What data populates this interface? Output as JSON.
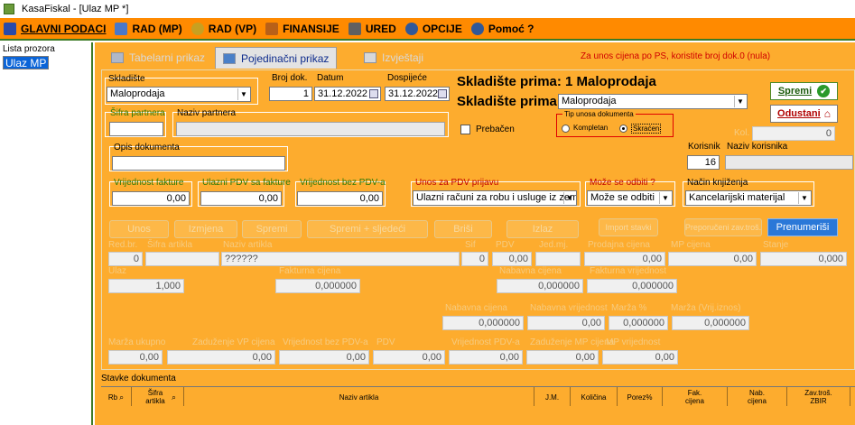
{
  "window": {
    "title": "KasaFiskal  - [Ulaz MP *]"
  },
  "menu": [
    {
      "label": "GLAVNI PODACI",
      "icon": "book-icon",
      "color": "#2a4aa8"
    },
    {
      "label": "RAD (MP)",
      "icon": "notepad-icon",
      "color": "#2a4aa8"
    },
    {
      "label": "RAD (VP)",
      "icon": "coins-icon",
      "color": "#c8a020"
    },
    {
      "label": "FINANSIJE",
      "icon": "box-icon",
      "color": "#b86018"
    },
    {
      "label": "URED",
      "icon": "tools-icon",
      "color": "#404040"
    },
    {
      "label": "OPCIJE",
      "icon": "globe-icon",
      "color": "#305898"
    },
    {
      "label": "Pomoć ?",
      "icon": "help-icon",
      "color": "#305898"
    }
  ],
  "sidebar": {
    "title": "Lista prozora",
    "selected": "Ulaz MP"
  },
  "tabs": [
    {
      "label": "Tabelarni prikaz"
    },
    {
      "label": "Pojedinačni prikaz"
    },
    {
      "label": "Izvještaji"
    }
  ],
  "notice": "Za unos cijena po PS, koristite broj dok.0 (nula)",
  "header": {
    "skladiste_label": "Skladište",
    "skladiste_value": "Maloprodaja",
    "broj_dok_label": "Broj dok.",
    "broj_dok_value": "1",
    "datum_label": "Datum",
    "datum_value": "31.12.2022",
    "dospijece_label": "Dospijeće",
    "dospijece_value": "31.12.2022",
    "big_title": "Skladište prima: 1 Maloprodaja",
    "prima_label": "Skladište prima:",
    "prima_value": "Maloprodaja",
    "sifra_partnera_label": "Šifra partnera",
    "naziv_partnera_label": "Naziv partnera",
    "prebacen_label": "Prebačen",
    "tip_unosa_label": "Tip unosa dokumenta",
    "kompletan_label": "Kompletan",
    "skracen_label": "Skraćen",
    "kol_label": "Kol.",
    "kol_value": "0",
    "korisnik_label": "Korisnik",
    "korisnik_value": "16",
    "naziv_korisnika_label": "Naziv korisnika",
    "opis_label": "Opis dokumenta",
    "vrijednost_fakture_label": "Vrijednost fakture",
    "vrijednost_fakture_value": "0,00",
    "ulazni_pdv_label": "Ulazni PDV sa fakture",
    "ulazni_pdv_value": "0,00",
    "bez_pdv_label": "Vrijednost bez PDV-a",
    "bez_pdv_value": "0,00",
    "unos_pdv_label": "Unos za PDV prijavu",
    "unos_pdv_value": "Ulazni računi za robu i usluge iz zemlje",
    "moze_odbiti_label": "Može se odbiti ?",
    "moze_odbiti_value": "Može se odbiti",
    "nacin_knjizenja_label": "Način knjiženja",
    "nacin_knjizenja_value": "Kancelarijski materijal",
    "spremi": "Spremi",
    "odustani": "Odustani"
  },
  "actions": {
    "unos": "Unos",
    "izmjena": "Izmjena",
    "spremi": "Spremi",
    "spremi_sljedeci": "Spremi + sljedeći",
    "brisi": "Briši",
    "izlaz": "Izlaz",
    "import": "Import stavki",
    "preporuceni": "Preporučeni zav.troš.",
    "preumerisi": "Prenumeriši"
  },
  "item": {
    "redbr_label": "Red.br.",
    "redbr_value": "0",
    "sifra_label": "Šifra artikla",
    "naziv_label": "Naziv artikla",
    "naziv_value": "??????",
    "sif_label": "Sif",
    "sif_value": "0",
    "pdv_label": "PDV",
    "pdv_value": "0,00",
    "jedmj_label": "Jed.mj.",
    "prodajna_label": "Prodajna cijena",
    "prodajna_value": "0,00",
    "mp_cijena_label": "MP cijena",
    "mp_cijena_value": "0,00",
    "stanje_label": "Stanje",
    "stanje_value": "0,000",
    "ulaz_label": "Ulaz",
    "ulaz_value": "1,000",
    "fakturna_cijena_label": "Fakturna cijena",
    "fakturna_cijena_value": "0,000000",
    "nabavna_cijena_label": "Nabavna cijena",
    "nabavna_cijena_value": "0,000000",
    "fakturna_vrijednost_label": "Fakturna vrijednost",
    "fakturna_vrijednost_value": "0,000000",
    "nabavna_cijena2_label": "Nabavna cijena",
    "nabavna_cijena2_value": "0,000000",
    "nabavna_vrijednost_label": "Nabavna vrijednost",
    "nabavna_vrijednost_value": "0,00",
    "marza_label": "Marža %",
    "marza_value": "0,000000",
    "marza_iznos_label": "Marža (Vrij.iznos)",
    "marza_iznos_value": "0,000000",
    "marza_ukupno_label": "Marža ukupno",
    "marza_ukupno_value": "0,00",
    "zaduzenje_vp_label": "Zaduženje VP cijena",
    "zaduzenje_vp_value": "0,00",
    "vrijednost_bez_pdv_label": "Vrijednost bez PDV-a",
    "vrijednost_bez_pdv_value": "0,00",
    "pdv2_label": "PDV",
    "pdv2_value": "0,00",
    "vrijednost_pdv_label": "Vrijednost PDV-a",
    "vrijednost_pdv_value": "0,00",
    "zaduzenje_mp_label": "Zaduženje MP cijena",
    "zaduzenje_mp_value": "0,00",
    "mp_vrijednost_label": "MP vrijednost",
    "mp_vrijednost_value": "0,00"
  },
  "grid": {
    "title": "Stavke dokumenta",
    "columns": [
      "Rb",
      "Šifra artikla",
      "Naziv artikla",
      "J.M.",
      "Količina",
      "Porez%",
      "Fak. cijena",
      "Nab. cijena",
      "Zav.troš. ZBIR"
    ]
  }
}
